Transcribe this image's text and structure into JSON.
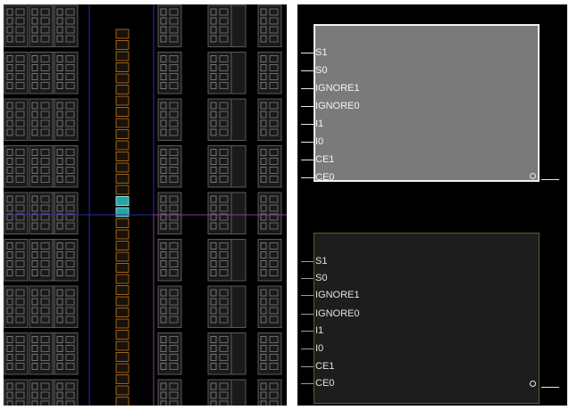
{
  "device_view": {
    "colors": {
      "background": "#000000",
      "tile_fill": "#1a1a1a",
      "tile_stroke": "#5a5a5a",
      "grid_line_blue": "#2c2ca8",
      "grid_line_magenta": "#8a3a8a",
      "interconnect_site": "#a0641e",
      "selected_site": "#2aa3a3"
    }
  },
  "schematic": {
    "colors": {
      "selected_fill": "#7a7a7a",
      "selected_border": "#f2f2f2",
      "normal_fill": "#1d1d1d",
      "normal_border": "#6b5a1c",
      "pin_text": "#f5f5f5"
    },
    "cells": [
      {
        "state": "selected",
        "pins": [
          "S1",
          "S0",
          "IGNORE1",
          "IGNORE0",
          "I1",
          "I0",
          "CE1",
          "CE0"
        ],
        "output_icon": "output-pin-circle-icon"
      },
      {
        "state": "normal",
        "pins": [
          "S1",
          "S0",
          "IGNORE1",
          "IGNORE0",
          "I1",
          "I0",
          "CE1",
          "CE0"
        ],
        "output_icon": "output-pin-circle-icon"
      }
    ]
  }
}
